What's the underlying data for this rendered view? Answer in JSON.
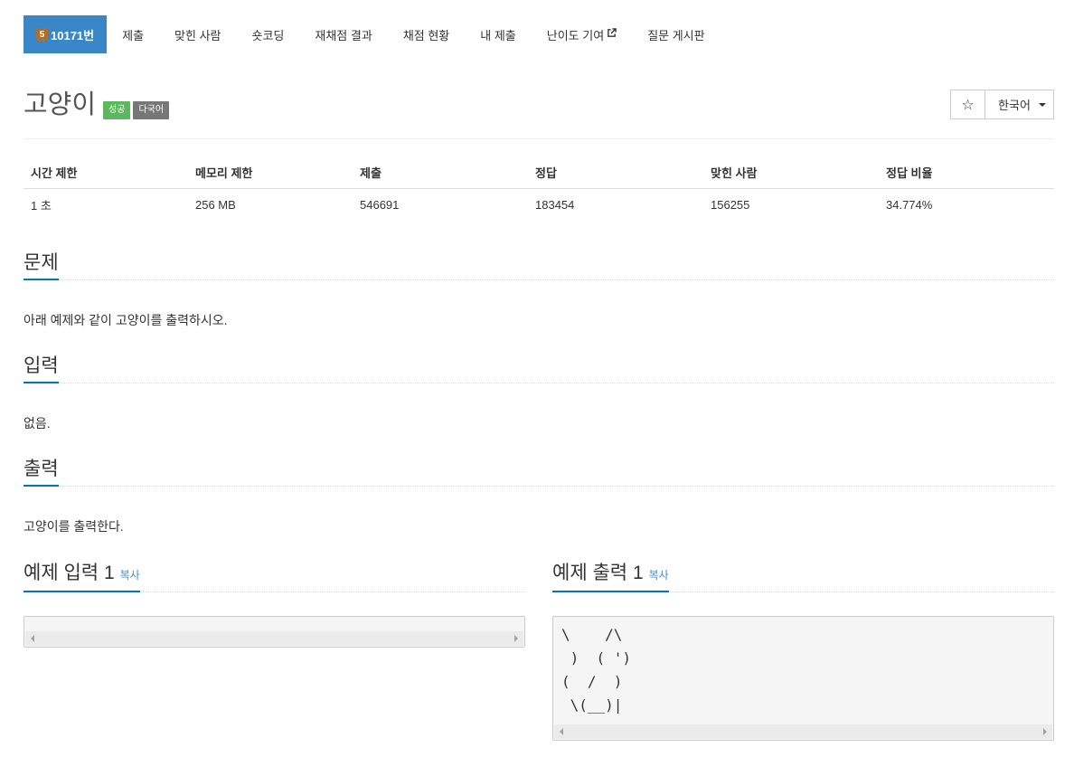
{
  "nav": {
    "tabs": [
      {
        "label": "10171번",
        "badge": "5",
        "active": true
      },
      {
        "label": "제출"
      },
      {
        "label": "맞힌 사람"
      },
      {
        "label": "숏코딩"
      },
      {
        "label": "재채점 결과"
      },
      {
        "label": "채점 현황"
      },
      {
        "label": "내 제출"
      },
      {
        "label": "난이도 기여",
        "icon": "external-link-icon"
      },
      {
        "label": "질문 게시판"
      }
    ]
  },
  "problem": {
    "title": "고양이",
    "labels": {
      "success": "성공",
      "multilang": "다국어"
    },
    "language_selector": "한국어",
    "star_icon": "☆"
  },
  "stats": {
    "headers": [
      "시간 제한",
      "메모리 제한",
      "제출",
      "정답",
      "맞힌 사람",
      "정답 비율"
    ],
    "values": [
      "1 초",
      "256 MB",
      "546691",
      "183454",
      "156255",
      "34.774%"
    ]
  },
  "sections": {
    "description": {
      "heading": "문제",
      "text": "아래 예제와 같이 고양이를 출력하시오."
    },
    "input": {
      "heading": "입력",
      "text": "없음."
    },
    "output": {
      "heading": "출력",
      "text": "고양이를 출력한다."
    }
  },
  "samples": {
    "input": {
      "heading": "예제 입력 1",
      "copy_label": "복사",
      "content": ""
    },
    "output": {
      "heading": "예제 출력 1",
      "copy_label": "복사",
      "content": "\\    /\\\n )  ( ')\n(  /  )\n \\(__)|"
    }
  },
  "colors": {
    "active_tab": "#3a87c8",
    "success": "#5cb85c",
    "default_label": "#777777",
    "link": "#428bca",
    "heading_underline": "#0076c0"
  }
}
